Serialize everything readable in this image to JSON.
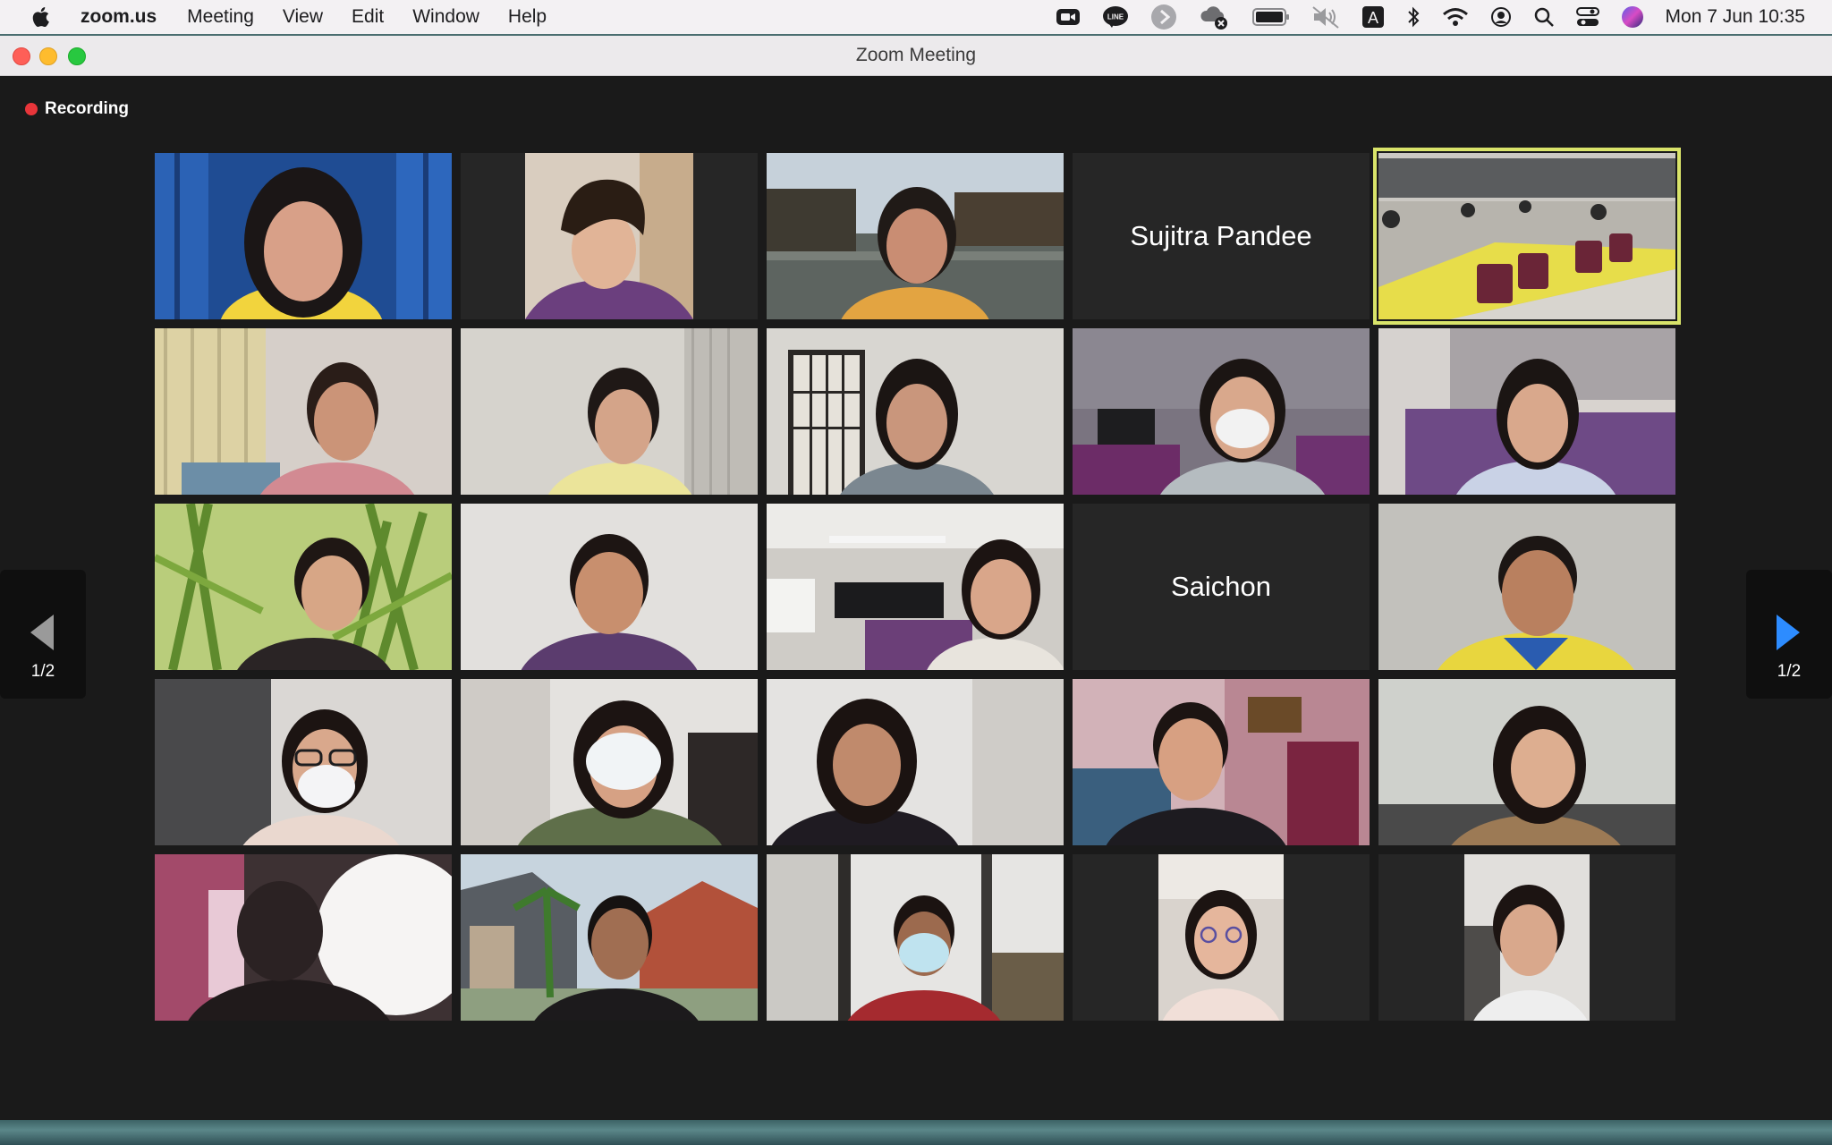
{
  "menubar": {
    "app_name": "zoom.us",
    "items": [
      "Meeting",
      "View",
      "Edit",
      "Window",
      "Help"
    ],
    "clock": "Mon 7 Jun  10:35",
    "tray_icons": [
      "zoom-icon",
      "line-icon",
      "play-icon",
      "cloud-icon",
      "battery-icon",
      "mute-icon",
      "input-source-icon",
      "bluetooth-icon",
      "wifi-icon",
      "user-icon",
      "search-icon",
      "control-center-icon",
      "siri-icon"
    ],
    "input_source_label": "A",
    "line_label": "LINE"
  },
  "window": {
    "title": "Zoom Meeting"
  },
  "recording": {
    "label": "Recording",
    "color": "#e8353a"
  },
  "gallery": {
    "active_border_color": "#d9e46a",
    "tiles": [
      {
        "kind": "video",
        "active": false
      },
      {
        "kind": "video",
        "active": false
      },
      {
        "kind": "video",
        "active": false
      },
      {
        "kind": "name",
        "name": "Sujitra Pandee",
        "active": false
      },
      {
        "kind": "video",
        "active": true
      },
      {
        "kind": "video",
        "active": false
      },
      {
        "kind": "video",
        "active": false
      },
      {
        "kind": "video",
        "active": false
      },
      {
        "kind": "video",
        "active": false
      },
      {
        "kind": "video",
        "active": false
      },
      {
        "kind": "video",
        "active": false
      },
      {
        "kind": "video",
        "active": false
      },
      {
        "kind": "video",
        "active": false
      },
      {
        "kind": "name",
        "name": "Saichon",
        "active": false
      },
      {
        "kind": "video",
        "active": false
      },
      {
        "kind": "video",
        "active": false
      },
      {
        "kind": "video",
        "active": false
      },
      {
        "kind": "video",
        "active": false
      },
      {
        "kind": "video",
        "active": false
      },
      {
        "kind": "video",
        "active": false
      },
      {
        "kind": "video",
        "active": false
      },
      {
        "kind": "video",
        "active": false
      },
      {
        "kind": "video",
        "active": false
      },
      {
        "kind": "video",
        "active": false
      },
      {
        "kind": "video",
        "active": false
      }
    ]
  },
  "pager": {
    "prev_label": "1/2",
    "next_label": "1/2",
    "next_arrow_color": "#2d8cff"
  }
}
